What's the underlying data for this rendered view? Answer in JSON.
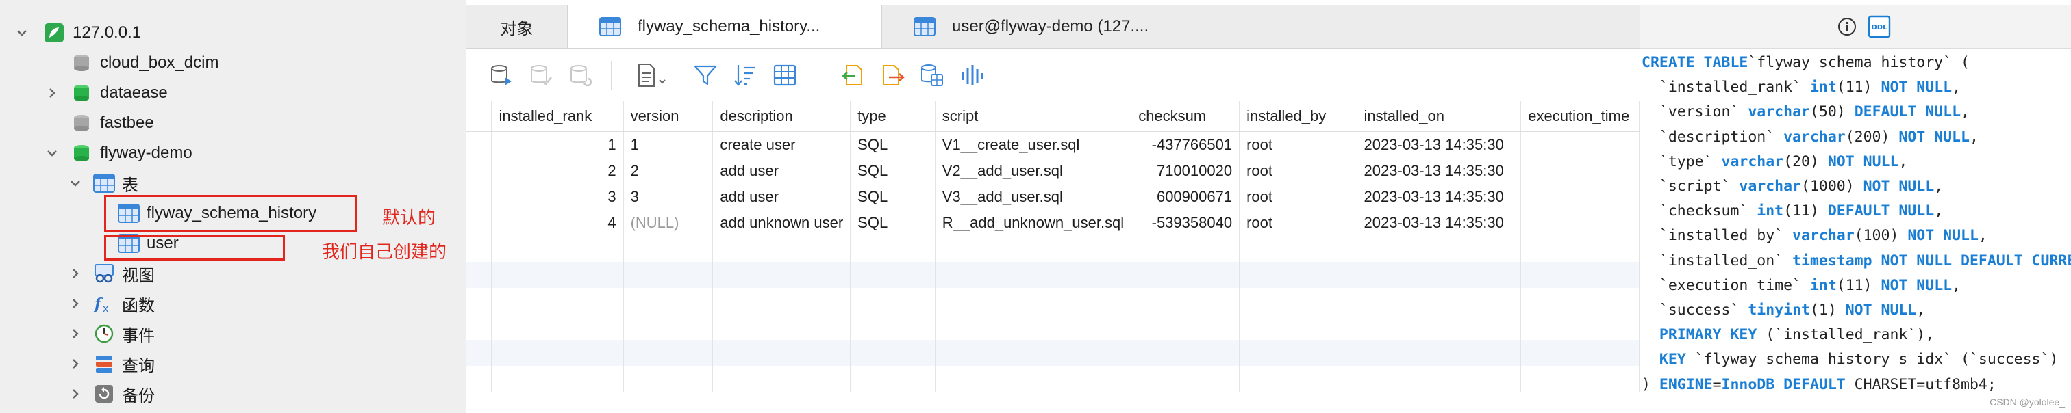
{
  "sidebar": {
    "connection": "127.0.0.1",
    "databases": [
      "cloud_box_dcim",
      "dataease",
      "fastbee",
      "flyway-demo"
    ],
    "folders": {
      "tables": "表",
      "views": "视图",
      "functions": "函数",
      "events": "事件",
      "queries": "查询",
      "backups": "备份"
    },
    "tables": [
      "flyway_schema_history",
      "user"
    ],
    "annotations": {
      "default": "默认的",
      "ours": "我们自己创建的"
    }
  },
  "tabs": [
    {
      "label": "对象"
    },
    {
      "label": "flyway_schema_history..."
    },
    {
      "label": "user@flyway-demo (127...."
    }
  ],
  "toolbar": {
    "icons": [
      "begin-transaction",
      "commit",
      "rollback",
      "text-view",
      "filter",
      "sort",
      "grid-view",
      "import",
      "export",
      "data-generator",
      "profile"
    ]
  },
  "grid": {
    "columns": [
      "installed_rank",
      "version",
      "description",
      "type",
      "script",
      "checksum",
      "installed_by",
      "installed_on",
      "execution_time"
    ],
    "rows": [
      [
        "1",
        "1",
        "create user",
        "SQL",
        "V1__create_user.sql",
        "-437766501",
        "root",
        "2023-03-13 14:35:30"
      ],
      [
        "2",
        "2",
        "add user",
        "SQL",
        "V2__add_user.sql",
        "710010020",
        "root",
        "2023-03-13 14:35:30"
      ],
      [
        "3",
        "3",
        "add user",
        "SQL",
        "V3__add_user.sql",
        "600900671",
        "root",
        "2023-03-13 14:35:30"
      ],
      [
        "4",
        "(NULL)",
        "add unknown user",
        "SQL",
        "R__add_unknown_user.sql",
        "-539358040",
        "root",
        "2023-03-13 14:35:30"
      ]
    ]
  },
  "ddl": {
    "lines": [
      [
        [
          "kw",
          "CREATE TABLE"
        ],
        [
          "",
          "`flyway_schema_history` ("
        ]
      ],
      [
        [
          "",
          "  `installed_rank` "
        ],
        [
          "kw",
          "int"
        ],
        [
          "",
          "(11) "
        ],
        [
          "kw",
          "NOT NULL"
        ],
        [
          "",
          ","
        ]
      ],
      [
        [
          "",
          "  `version` "
        ],
        [
          "kw",
          "varchar"
        ],
        [
          "",
          "(50) "
        ],
        [
          "kw",
          "DEFAULT NULL"
        ],
        [
          "",
          ","
        ]
      ],
      [
        [
          "",
          "  `description` "
        ],
        [
          "kw",
          "varchar"
        ],
        [
          "",
          "(200) "
        ],
        [
          "kw",
          "NOT NULL"
        ],
        [
          "",
          ","
        ]
      ],
      [
        [
          "",
          "  `type` "
        ],
        [
          "kw",
          "varchar"
        ],
        [
          "",
          "(20) "
        ],
        [
          "kw",
          "NOT NULL"
        ],
        [
          "",
          ","
        ]
      ],
      [
        [
          "",
          "  `script` "
        ],
        [
          "kw",
          "varchar"
        ],
        [
          "",
          "(1000) "
        ],
        [
          "kw",
          "NOT NULL"
        ],
        [
          "",
          ","
        ]
      ],
      [
        [
          "",
          "  `checksum` "
        ],
        [
          "kw",
          "int"
        ],
        [
          "",
          "(11) "
        ],
        [
          "kw",
          "DEFAULT NULL"
        ],
        [
          "",
          ","
        ]
      ],
      [
        [
          "",
          "  `installed_by` "
        ],
        [
          "kw",
          "varchar"
        ],
        [
          "",
          "(100) "
        ],
        [
          "kw",
          "NOT NULL"
        ],
        [
          "",
          ","
        ]
      ],
      [
        [
          "",
          "  `installed_on` "
        ],
        [
          "kw",
          "timestamp NOT NULL DEFAULT CURRENT_TIMESTAMP"
        ]
      ],
      [
        [
          "",
          "  `execution_time` "
        ],
        [
          "kw",
          "int"
        ],
        [
          "",
          "(11) "
        ],
        [
          "kw",
          "NOT NULL"
        ],
        [
          "",
          ","
        ]
      ],
      [
        [
          "",
          "  `success` "
        ],
        [
          "kw",
          "tinyint"
        ],
        [
          "",
          "(1) "
        ],
        [
          "kw",
          "NOT NULL"
        ],
        [
          "",
          ","
        ]
      ],
      [
        [
          "kw",
          "  PRIMARY KEY"
        ],
        [
          "",
          " (`installed_rank`),"
        ]
      ],
      [
        [
          "kw",
          "  KEY"
        ],
        [
          "",
          " `flyway_schema_history_s_idx` (`success`)"
        ]
      ],
      [
        [
          "",
          ") "
        ],
        [
          "kw",
          "ENGINE"
        ],
        [
          "",
          "="
        ],
        [
          "kw",
          "InnoDB DEFAULT"
        ],
        [
          "",
          " CHARSET=utf8mb4;"
        ]
      ]
    ],
    "watermark": "CSDN @yololee_"
  },
  "colors": {
    "accent": "#1a7fd4",
    "annotation": "#e2261d",
    "db_green": "#29b14a"
  }
}
